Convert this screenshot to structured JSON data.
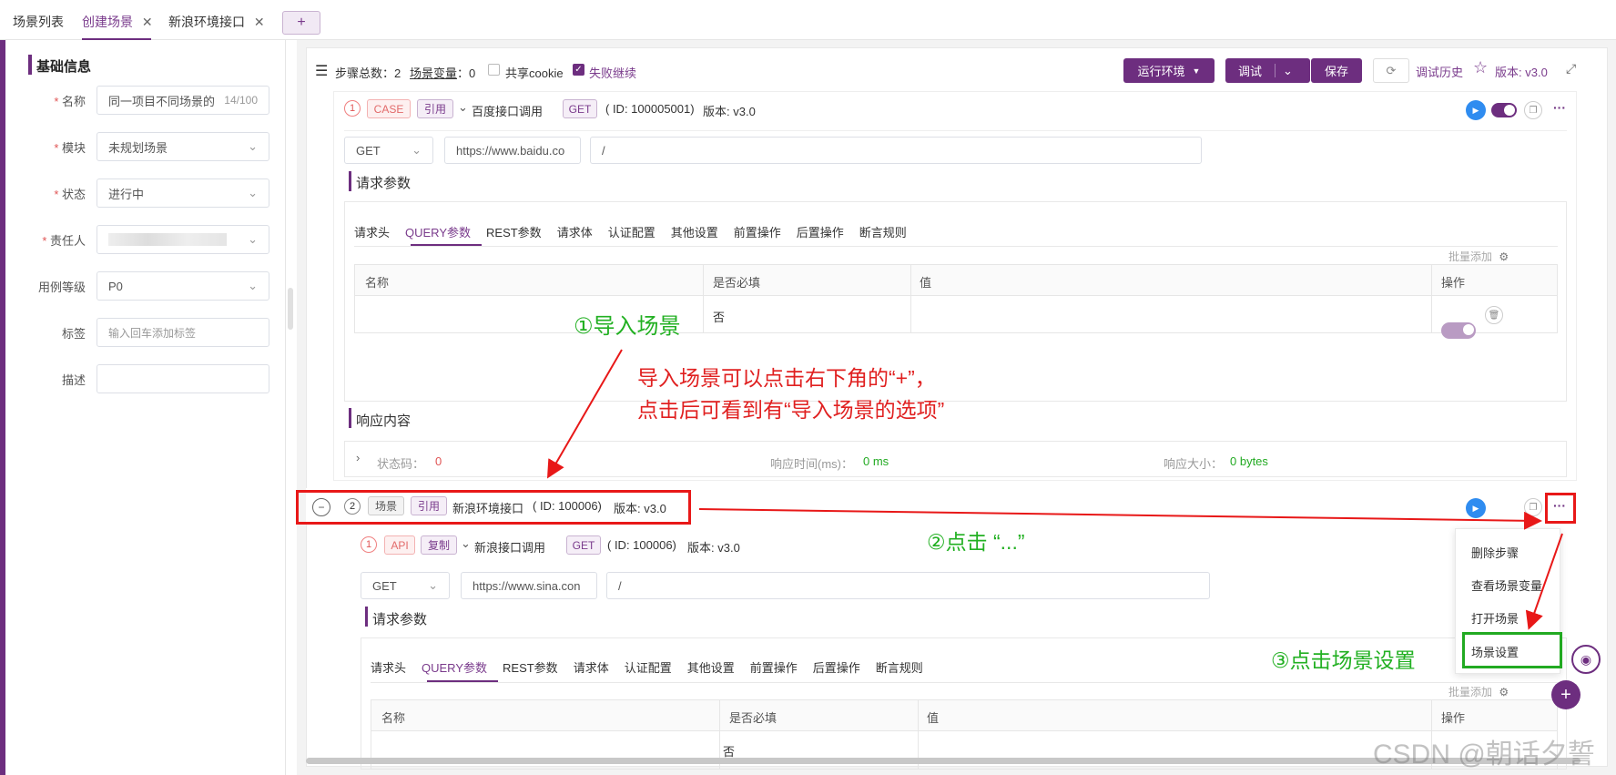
{
  "top_tabs": [
    {
      "label": "场景列表",
      "active": false,
      "closable": false
    },
    {
      "label": "创建场景",
      "active": true,
      "closable": true
    },
    {
      "label": "新浪环境接口",
      "active": false,
      "closable": true
    }
  ],
  "add_tab_label": "+",
  "left_panel": {
    "title": "基础信息",
    "fields": {
      "name": {
        "label": "名称",
        "value": "同一项目不同场景的",
        "counter": "14/100"
      },
      "module": {
        "label": "模块",
        "value": "未规划场景"
      },
      "status": {
        "label": "状态",
        "value": "进行中"
      },
      "owner": {
        "label": "责任人",
        "value": ""
      },
      "level": {
        "label": "用例等级",
        "value": "P0"
      },
      "tags": {
        "label": "标签",
        "placeholder": "输入回车添加标签"
      },
      "desc": {
        "label": "描述",
        "value": ""
      }
    }
  },
  "toolbar": {
    "steps_label": "步骤总数：2",
    "vars_label": "场景变量",
    "vars_count": "：0",
    "share_cookie": "共享cookie",
    "fail_continue": "失败继续",
    "env_btn": "运行环境",
    "debug_btn": "调试",
    "save_btn": "保存",
    "history": "调试历史",
    "version": "版本: v3.0"
  },
  "step1": {
    "num": "1",
    "type_tag": "CASE",
    "ref_tag": "引用",
    "title": "百度接口调用",
    "method_tag": "GET",
    "id_text": "( ID: 100005001)",
    "version": "版本: v3.0",
    "method": "GET",
    "url": "https://www.baidu.co",
    "path": "/",
    "req_params_title": "请求参数",
    "tabs": [
      "请求头",
      "QUERY参数",
      "REST参数",
      "请求体",
      "认证配置",
      "其他设置",
      "前置操作",
      "后置操作",
      "断言规则"
    ],
    "batch_add": "批量添加",
    "columns": [
      "名称",
      "是否必填",
      "值",
      "操作"
    ],
    "row_required": "否",
    "resp_title": "响应内容",
    "status_label": "状态码：",
    "status_value": "0",
    "time_label": "响应时间(ms)：",
    "time_value": "0 ms",
    "size_label": "响应大小：",
    "size_value": "0 bytes"
  },
  "step2": {
    "num": "2",
    "type_tag": "场景",
    "ref_tag": "引用",
    "title": "新浪环境接口",
    "id_text": "( ID: 100006)",
    "version": "版本: v3.0"
  },
  "step2_1": {
    "num": "1",
    "type_tag": "API",
    "copy_tag": "复制",
    "title": "新浪接口调用",
    "method_tag": "GET",
    "id_text": "( ID: 100006)",
    "version": "版本: v3.0",
    "method": "GET",
    "url": "https://www.sina.con",
    "path": "/",
    "req_params_title": "请求参数",
    "tabs": [
      "请求头",
      "QUERY参数",
      "REST参数",
      "请求体",
      "认证配置",
      "其他设置",
      "前置操作",
      "后置操作",
      "断言规则"
    ],
    "batch_add": "批量添加",
    "columns": [
      "名称",
      "是否必填",
      "值",
      "操作"
    ],
    "row_required": "否"
  },
  "menu": [
    "删除步骤",
    "查看场景变量",
    "打开场景",
    "场景设置"
  ],
  "annotations": {
    "a1": "①导入场景",
    "a1_desc_1": "导入场景可以点击右下角的“+”，",
    "a1_desc_2": "点击后可看到有“导入场景的选项”",
    "a2": "②点击 “...”",
    "a3": "③点击场景设置"
  },
  "watermark": "CSDN @朝话夕誓"
}
